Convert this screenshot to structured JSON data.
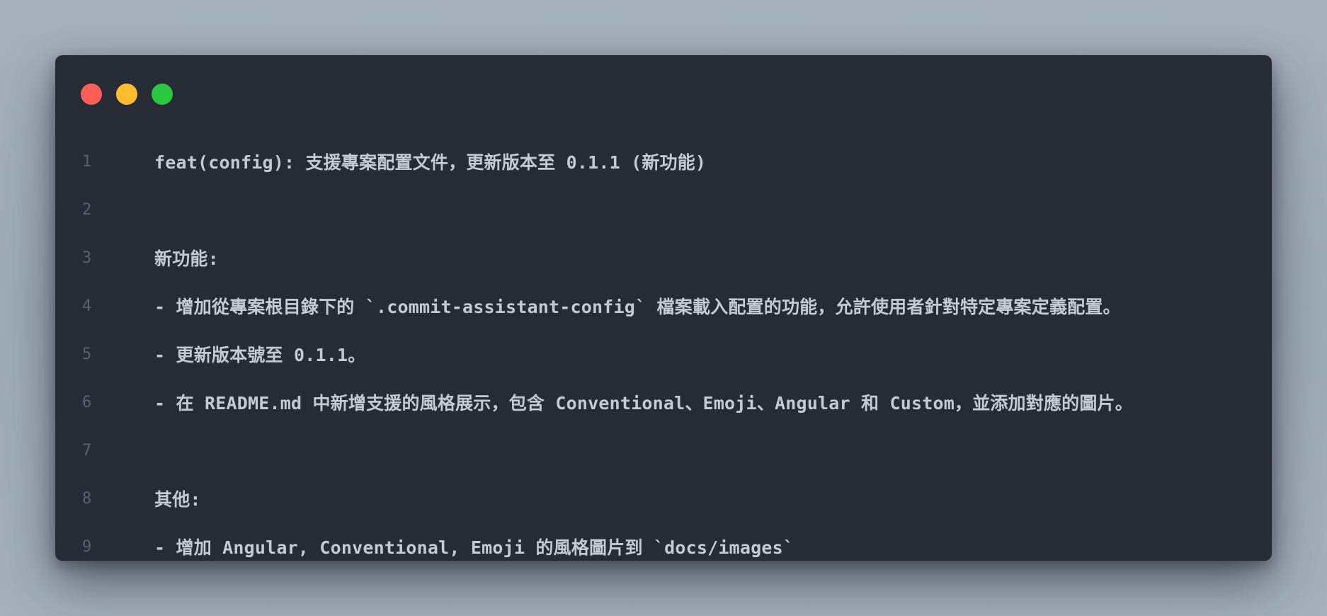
{
  "window": {
    "controls": [
      "close",
      "minimize",
      "maximize"
    ]
  },
  "colors": {
    "background": "#a2adb9",
    "window": "#272b35",
    "text": "#c4c9d4",
    "line_number": "#5b6170",
    "close": "#ff5f57",
    "minimize": "#febc2e",
    "maximize": "#28c840"
  },
  "lines": [
    {
      "num": "1",
      "text": "feat(config): 支援專案配置文件，更新版本至 0.1.1 (新功能)"
    },
    {
      "num": "2",
      "text": ""
    },
    {
      "num": "3",
      "text": "新功能:"
    },
    {
      "num": "4",
      "text": "- 增加從專案根目錄下的 `.commit-assistant-config` 檔案載入配置的功能，允許使用者針對特定專案定義配置。"
    },
    {
      "num": "5",
      "text": "- 更新版本號至 0.1.1。"
    },
    {
      "num": "6",
      "text": "- 在 README.md 中新增支援的風格展示，包含 Conventional、Emoji、Angular 和 Custom，並添加對應的圖片。"
    },
    {
      "num": "7",
      "text": ""
    },
    {
      "num": "8",
      "text": "其他:"
    },
    {
      "num": "9",
      "text": "- 增加 Angular, Conventional, Emoji 的風格圖片到 `docs/images`"
    }
  ]
}
